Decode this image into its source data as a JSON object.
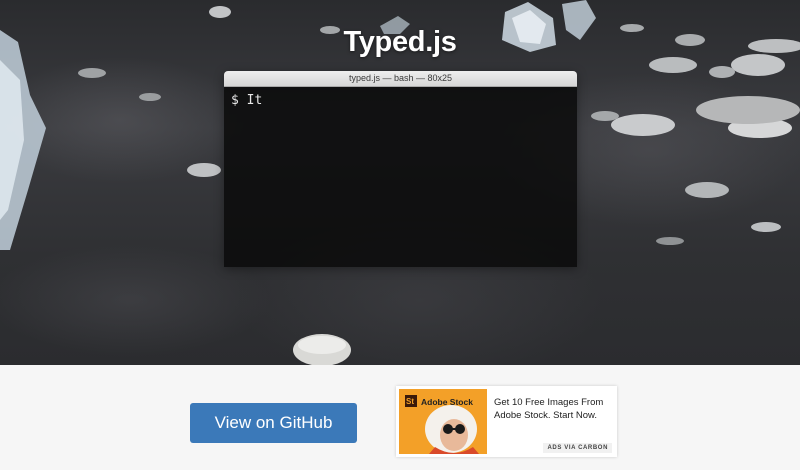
{
  "hero": {
    "title": "Typed.js"
  },
  "terminal": {
    "title": "typed.js — bash — 80x25",
    "prompt": "$",
    "typed_text": "It"
  },
  "actions": {
    "github_label": "View on GitHub"
  },
  "ad": {
    "brand_mark": "St",
    "brand_name": "Adobe Stock",
    "text": "Get 10 Free Images From Adobe Stock. Start Now.",
    "tag": "ADS VIA CARBON"
  },
  "colors": {
    "github_button": "#3b79b9",
    "ad_image_bg": "#f3a028",
    "terminal_bg": "#0b0b0c"
  }
}
